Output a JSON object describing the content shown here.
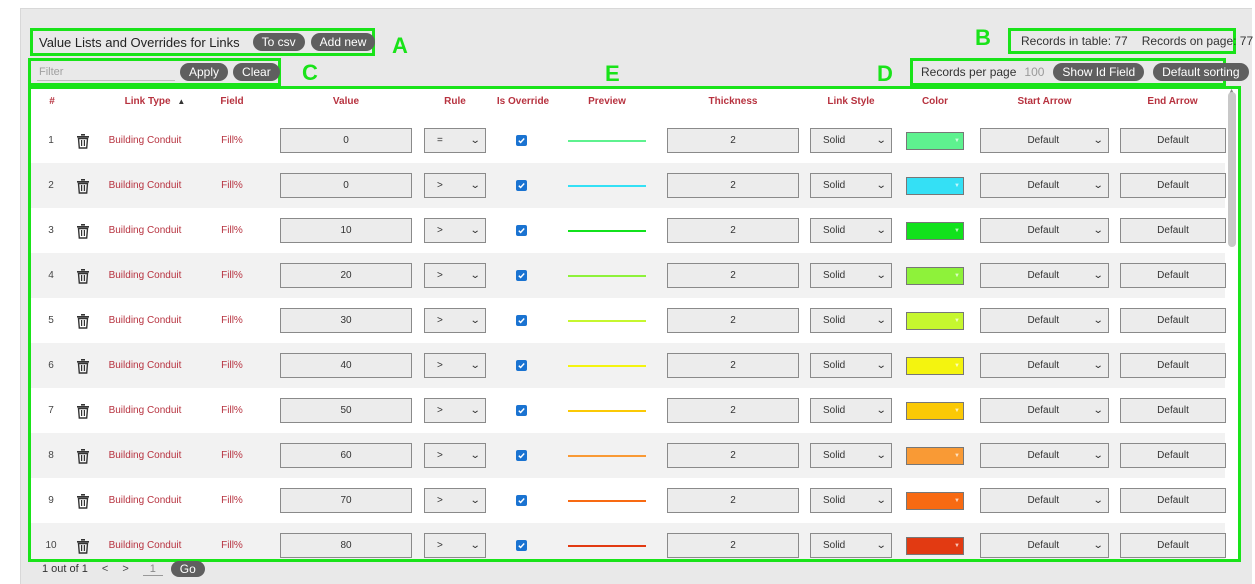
{
  "header": {
    "title": "Value Lists and Overrides for Links",
    "to_csv": "To csv",
    "add_new": "Add new",
    "records_in_table": "Records in table: 77",
    "records_on_page": "Records on page: 77"
  },
  "filter": {
    "placeholder": "Filter",
    "apply": "Apply",
    "clear": "Clear"
  },
  "paging": {
    "records_per_page_label": "Records per page",
    "records_per_page_value": "100",
    "show_id_field": "Show Id Field",
    "default_sorting": "Default sorting",
    "page_info": "1 out of 1",
    "prev": "<",
    "next": ">",
    "page_input": "1",
    "go": "Go"
  },
  "annotations": [
    "A",
    "B",
    "C",
    "D",
    "E"
  ],
  "columns": {
    "num": "#",
    "link_type": "Link Type",
    "sort_indicator": "▲",
    "field": "Field",
    "value": "Value",
    "rule": "Rule",
    "is_override": "Is Override",
    "preview": "Preview",
    "thickness": "Thickness",
    "link_style": "Link Style",
    "color": "Color",
    "start_arrow": "Start Arrow",
    "end_arrow": "End Arrow"
  },
  "rows": [
    {
      "num": "1",
      "link_type": "Building Conduit",
      "field": "Fill%",
      "value": "0",
      "rule": "=",
      "is_override": true,
      "thickness": "2",
      "link_style": "Solid",
      "color": "#5ef28f",
      "start_arrow": "Default",
      "end_arrow": "Default"
    },
    {
      "num": "2",
      "link_type": "Building Conduit",
      "field": "Fill%",
      "value": "0",
      "rule": ">",
      "is_override": true,
      "thickness": "2",
      "link_style": "Solid",
      "color": "#34e0f5",
      "start_arrow": "Default",
      "end_arrow": "Default"
    },
    {
      "num": "3",
      "link_type": "Building Conduit",
      "field": "Fill%",
      "value": "10",
      "rule": ">",
      "is_override": true,
      "thickness": "2",
      "link_style": "Solid",
      "color": "#11e21c",
      "start_arrow": "Default",
      "end_arrow": "Default"
    },
    {
      "num": "4",
      "link_type": "Building Conduit",
      "field": "Fill%",
      "value": "20",
      "rule": ">",
      "is_override": true,
      "thickness": "2",
      "link_style": "Solid",
      "color": "#8ef23a",
      "start_arrow": "Default",
      "end_arrow": "Default"
    },
    {
      "num": "5",
      "link_type": "Building Conduit",
      "field": "Fill%",
      "value": "30",
      "rule": ">",
      "is_override": true,
      "thickness": "2",
      "link_style": "Solid",
      "color": "#c6f72f",
      "start_arrow": "Default",
      "end_arrow": "Default"
    },
    {
      "num": "6",
      "link_type": "Building Conduit",
      "field": "Fill%",
      "value": "40",
      "rule": ">",
      "is_override": true,
      "thickness": "2",
      "link_style": "Solid",
      "color": "#f4f40f",
      "start_arrow": "Default",
      "end_arrow": "Default"
    },
    {
      "num": "7",
      "link_type": "Building Conduit",
      "field": "Fill%",
      "value": "50",
      "rule": ">",
      "is_override": true,
      "thickness": "2",
      "link_style": "Solid",
      "color": "#fbc905",
      "start_arrow": "Default",
      "end_arrow": "Default"
    },
    {
      "num": "8",
      "link_type": "Building Conduit",
      "field": "Fill%",
      "value": "60",
      "rule": ">",
      "is_override": true,
      "thickness": "2",
      "link_style": "Solid",
      "color": "#f99a35",
      "start_arrow": "Default",
      "end_arrow": "Default"
    },
    {
      "num": "9",
      "link_type": "Building Conduit",
      "field": "Fill%",
      "value": "70",
      "rule": ">",
      "is_override": true,
      "thickness": "2",
      "link_style": "Solid",
      "color": "#f86a12",
      "start_arrow": "Default",
      "end_arrow": "Default"
    },
    {
      "num": "10",
      "link_type": "Building Conduit",
      "field": "Fill%",
      "value": "80",
      "rule": ">",
      "is_override": true,
      "thickness": "2",
      "link_style": "Solid",
      "color": "#e23a12",
      "start_arrow": "Default",
      "end_arrow": "Default"
    }
  ],
  "colors": {
    "annotation": "#19e319",
    "header_text": "#b7323f",
    "pill": "#5f5f5f",
    "checkbox": "#1a73d1"
  }
}
